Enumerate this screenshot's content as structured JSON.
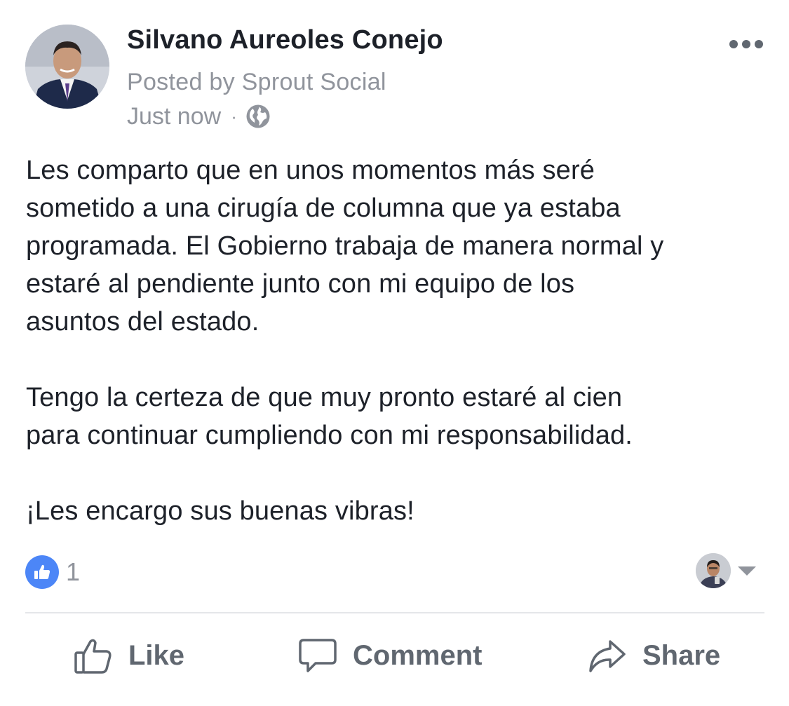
{
  "post": {
    "author": "Silvano Aureoles Conejo",
    "posted_by": "Posted by Sprout Social",
    "timestamp": "Just now",
    "separator": "·",
    "audience_icon": "globe-icon",
    "more_icon": "more-options-icon",
    "body": {
      "paragraph1": [
        "Les comparto que en unos momentos más seré",
        "sometido a una cirugía de columna que ya estaba",
        "programada. El Gobierno trabaja de manera normal y",
        "estaré al pendiente junto con mi equipo de los",
        "asuntos del estado."
      ],
      "paragraph2": [
        "Tengo la certeza de que muy pronto estaré al cien",
        "para continuar cumpliendo con mi responsabilidad."
      ],
      "paragraph3": [
        "¡Les encargo sus buenas vibras!"
      ]
    }
  },
  "reactions": {
    "icon": "thumbs-up-icon",
    "count": "1",
    "accent": "#4c86f7"
  },
  "actions": {
    "like_label": "Like",
    "comment_label": "Comment",
    "share_label": "Share"
  },
  "colors": {
    "text": "#1d2129",
    "secondary_text": "#90949c",
    "action_text": "#606770",
    "divider": "#e5e6e9"
  }
}
